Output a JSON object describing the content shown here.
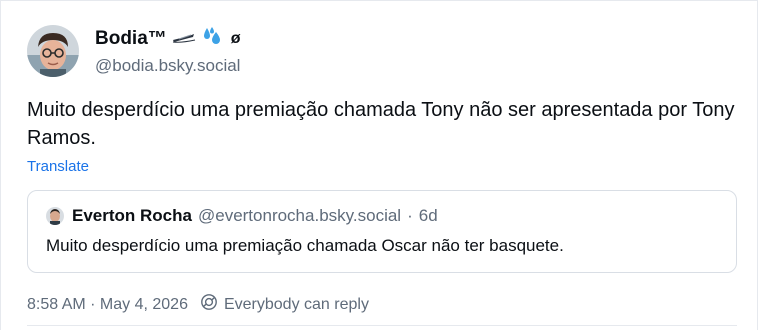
{
  "post": {
    "author": {
      "display_name": "Bodia™",
      "name_suffix": "ø",
      "handle": "@bodia.bsky.social",
      "name_icons": [
        "pen-icon",
        "droplets-icon"
      ]
    },
    "text": "Muito desperdício uma premiação chamada Tony não ser apresentada por Tony Ramos.",
    "translate_label": "Translate",
    "quote": {
      "author_name": "Everton Rocha",
      "author_handle": "@evertonrocha.bsky.social",
      "separator": "·",
      "time": "6d",
      "text": "Muito desperdício uma premiação chamada Oscar não ter basquete."
    },
    "meta": {
      "timestamp": "8:58 AM · May 4, 2026",
      "reply_setting": "Everybody can reply"
    }
  },
  "colors": {
    "text_primary": "#0b0f14",
    "text_secondary": "#5f6b7a",
    "link": "#1a73e8",
    "border": "#d9dee5"
  }
}
